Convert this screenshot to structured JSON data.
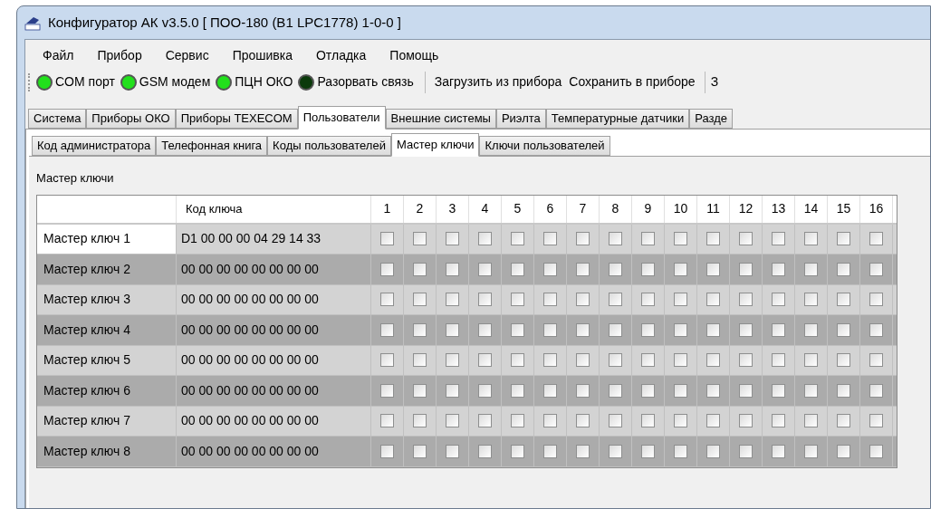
{
  "window": {
    "title": "Конфигуратор АК v3.5.0 [ ПОО-180 (В1 LPC1778) 1-0-0 ]"
  },
  "menu": [
    "Файл",
    "Прибор",
    "Сервис",
    "Прошивка",
    "Отладка",
    "Помощь"
  ],
  "toolbar": {
    "indicators": [
      {
        "label": "COM порт",
        "on": true
      },
      {
        "label": "GSM модем",
        "on": true
      },
      {
        "label": "ПЦН ОКО",
        "on": true
      },
      {
        "label": "Разорвать связь",
        "on": false
      }
    ],
    "actions": [
      "Загрузить из прибора",
      "Сохранить в приборе"
    ],
    "cut_action": "З"
  },
  "tabs": [
    {
      "label": "Система",
      "selected": false
    },
    {
      "label": "Приборы ОКО",
      "selected": false
    },
    {
      "label": "Приборы TEXECOM",
      "selected": false
    },
    {
      "label": "Пользователи",
      "selected": true
    },
    {
      "label": "Внешние системы",
      "selected": false
    },
    {
      "label": "Риэлта",
      "selected": false
    },
    {
      "label": "Температурные датчики",
      "selected": false
    },
    {
      "label": "Разде",
      "selected": false
    }
  ],
  "subtabs": [
    {
      "label": "Код администратора",
      "selected": false
    },
    {
      "label": "Телефонная книга",
      "selected": false
    },
    {
      "label": "Коды пользователей",
      "selected": false
    },
    {
      "label": "Мастер ключи",
      "selected": true
    },
    {
      "label": "Ключи пользователей",
      "selected": false
    }
  ],
  "group": {
    "title": "Мастер ключи"
  },
  "table": {
    "columns": [
      "Код ключа",
      "1",
      "2",
      "3",
      "4",
      "5",
      "6",
      "7",
      "8",
      "9",
      "10",
      "11",
      "12",
      "13",
      "14",
      "15",
      "16"
    ],
    "rows": [
      {
        "name": "Мастер ключ 1",
        "code": "D1 00 00 00 04 29 14 33",
        "selected": true,
        "checks": [
          false,
          false,
          false,
          false,
          false,
          false,
          false,
          false,
          false,
          false,
          false,
          false,
          false,
          false,
          false,
          false
        ]
      },
      {
        "name": "Мастер ключ 2",
        "code": "00 00 00 00 00 00 00 00",
        "selected": false,
        "checks": [
          false,
          false,
          false,
          false,
          false,
          false,
          false,
          false,
          false,
          false,
          false,
          false,
          false,
          false,
          false,
          false
        ]
      },
      {
        "name": "Мастер ключ 3",
        "code": "00 00 00 00 00 00 00 00",
        "selected": false,
        "checks": [
          false,
          false,
          false,
          false,
          false,
          false,
          false,
          false,
          false,
          false,
          false,
          false,
          false,
          false,
          false,
          false
        ]
      },
      {
        "name": "Мастер ключ 4",
        "code": "00 00 00 00 00 00 00 00",
        "selected": false,
        "checks": [
          false,
          false,
          false,
          false,
          false,
          false,
          false,
          false,
          false,
          false,
          false,
          false,
          false,
          false,
          false,
          false
        ]
      },
      {
        "name": "Мастер ключ 5",
        "code": "00 00 00 00 00 00 00 00",
        "selected": false,
        "checks": [
          false,
          false,
          false,
          false,
          false,
          false,
          false,
          false,
          false,
          false,
          false,
          false,
          false,
          false,
          false,
          false
        ]
      },
      {
        "name": "Мастер ключ 6",
        "code": "00 00 00 00 00 00 00 00",
        "selected": false,
        "checks": [
          false,
          false,
          false,
          false,
          false,
          false,
          false,
          false,
          false,
          false,
          false,
          false,
          false,
          false,
          false,
          false
        ]
      },
      {
        "name": "Мастер ключ 7",
        "code": "00 00 00 00 00 00 00 00",
        "selected": false,
        "checks": [
          false,
          false,
          false,
          false,
          false,
          false,
          false,
          false,
          false,
          false,
          false,
          false,
          false,
          false,
          false,
          false
        ]
      },
      {
        "name": "Мастер ключ 8",
        "code": "00 00 00 00 00 00 00 00",
        "selected": false,
        "checks": [
          false,
          false,
          false,
          false,
          false,
          false,
          false,
          false,
          false,
          false,
          false,
          false,
          false,
          false,
          false,
          false
        ]
      }
    ]
  }
}
